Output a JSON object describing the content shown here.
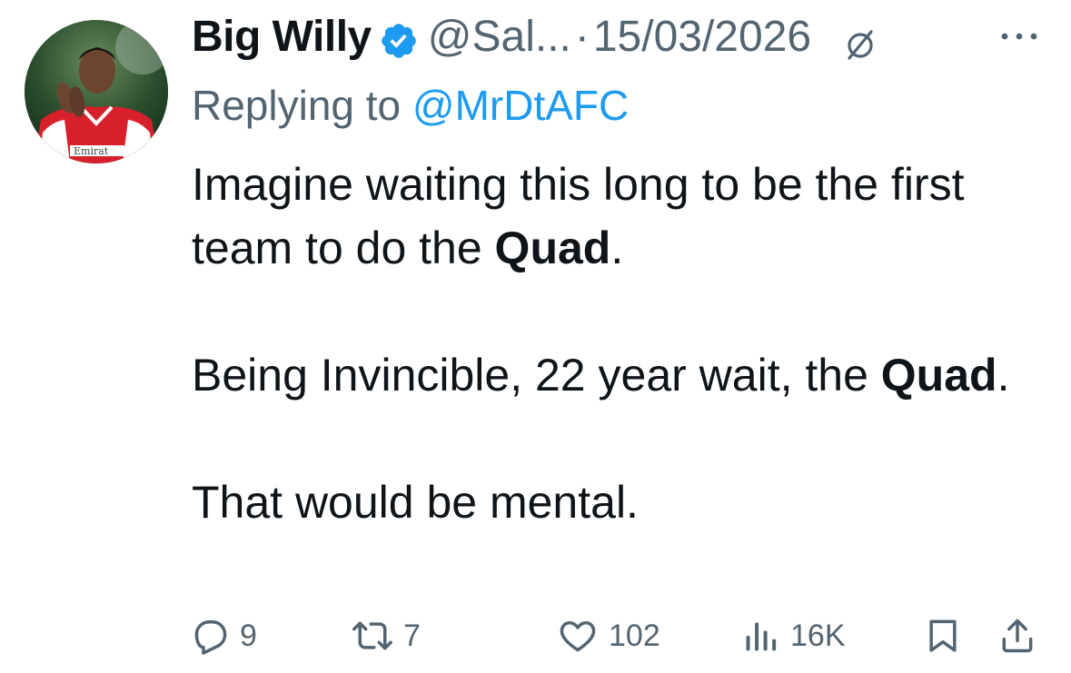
{
  "author": {
    "display_name": "Big Willy",
    "handle": "@Sal...",
    "separator": "·",
    "date": "15/03/2026",
    "verified": true,
    "avatar_text": "Emirat"
  },
  "reply": {
    "prefix": "Replying to",
    "handle": "@MrDtAFC"
  },
  "body": {
    "p1_before": "Imagine waiting this long to be the first team to do the ",
    "p1_bold": "Quad",
    "p1_after": ".",
    "p2_before": "Being Invincible, 22 year wait, the ",
    "p2_bold": "Quad",
    "p2_after": ".",
    "p3": "That would be mental."
  },
  "actions": {
    "replies": "9",
    "reposts": "7",
    "likes": "102",
    "views": "16K"
  },
  "icons": {
    "verified": "verified-badge-icon",
    "edited": "edited-icon",
    "more": "more-icon",
    "reply": "reply-icon",
    "repost": "repost-icon",
    "like": "heart-icon",
    "views": "views-icon",
    "bookmark": "bookmark-icon",
    "share": "share-icon"
  },
  "colors": {
    "text": "#0f1419",
    "secondary": "#536471",
    "accent": "#1d9bf0"
  }
}
